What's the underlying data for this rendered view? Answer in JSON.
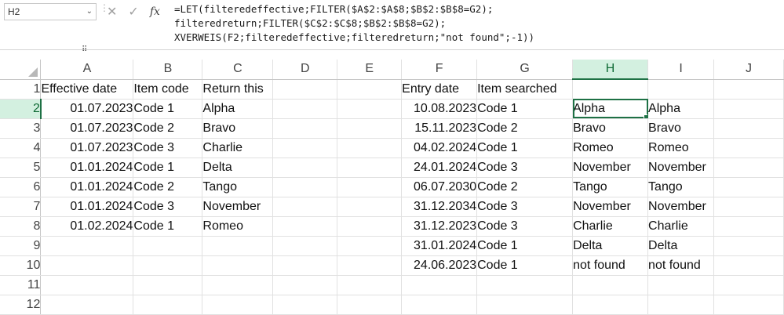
{
  "namebox": {
    "value": "H2"
  },
  "formula_icons": {
    "cancel": "close-icon",
    "enter": "check-icon",
    "function": "fx"
  },
  "formula": {
    "line1": "=LET(filteredeffective;FILTER($A$2:$A$8;$B$2:$B$8=G2);",
    "line2": "filteredreturn;FILTER($C$2:$C$8;$B$2:$B$8=G2);",
    "line3": "XVERWEIS(F2;filteredeffective;filteredreturn;\"not found\";-1))"
  },
  "columns": [
    "A",
    "B",
    "C",
    "D",
    "E",
    "F",
    "G",
    "H",
    "I",
    "J"
  ],
  "active_column": "H",
  "active_row": "2",
  "rows": [
    {
      "n": "1",
      "cells": [
        "Effective date",
        "Item code",
        "Return this",
        "",
        "",
        "Entry date",
        "Item searched",
        "",
        ""
      ]
    },
    {
      "n": "2",
      "cells": [
        "01.07.2023",
        "Code 1",
        "Alpha",
        "",
        "",
        "10.08.2023",
        "Code 1",
        "Alpha",
        "Alpha"
      ]
    },
    {
      "n": "3",
      "cells": [
        "01.07.2023",
        "Code 2",
        "Bravo",
        "",
        "",
        "15.11.2023",
        "Code 2",
        "Bravo",
        "Bravo"
      ]
    },
    {
      "n": "4",
      "cells": [
        "01.07.2023",
        "Code 3",
        "Charlie",
        "",
        "",
        "04.02.2024",
        "Code 1",
        "Romeo",
        "Romeo"
      ]
    },
    {
      "n": "5",
      "cells": [
        "01.01.2024",
        "Code 1",
        "Delta",
        "",
        "",
        "24.01.2024",
        "Code 3",
        "November",
        "November"
      ]
    },
    {
      "n": "6",
      "cells": [
        "01.01.2024",
        "Code 2",
        "Tango",
        "",
        "",
        "06.07.2030",
        "Code 2",
        "Tango",
        "Tango"
      ]
    },
    {
      "n": "7",
      "cells": [
        "01.01.2024",
        "Code 3",
        "November",
        "",
        "",
        "31.12.2034",
        "Code 3",
        "November",
        "November"
      ]
    },
    {
      "n": "8",
      "cells": [
        "01.02.2024",
        "Code 1",
        "Romeo",
        "",
        "",
        "31.12.2023",
        "Code 3",
        "Charlie",
        "Charlie"
      ]
    },
    {
      "n": "9",
      "cells": [
        "",
        "",
        "",
        "",
        "",
        "31.01.2024",
        "Code 1",
        "Delta",
        "Delta"
      ]
    },
    {
      "n": "10",
      "cells": [
        "",
        "",
        "",
        "",
        "",
        "24.06.2023",
        "Code 1",
        "not found",
        "not found"
      ]
    },
    {
      "n": "11",
      "cells": [
        "",
        "",
        "",
        "",
        "",
        "",
        "",
        "",
        ""
      ]
    },
    {
      "n": "12",
      "cells": [
        "",
        "",
        "",
        "",
        "",
        "",
        "",
        "",
        ""
      ]
    }
  ]
}
